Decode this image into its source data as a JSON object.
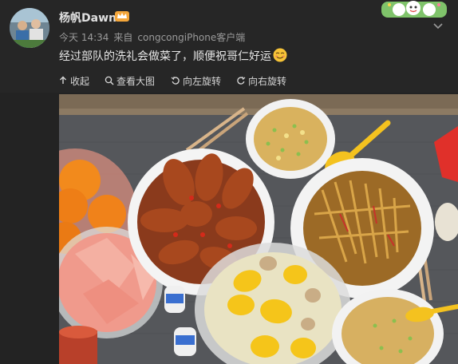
{
  "post": {
    "username": "杨帆Dawn",
    "timestamp": "今天 14:34",
    "source_prefix": "来自",
    "source": "congcongiPhone客户端",
    "text": "经过部队的洗礼会做菜了，顺便祝哥仁好运"
  },
  "toolbar": {
    "collapse_label": "收起",
    "view_large_label": "查看大图",
    "rotate_left_label": "向左旋转",
    "rotate_right_label": "向右旋转"
  },
  "icons": {
    "collapse": "collapse-arrow-icon",
    "view_large": "magnifier-icon",
    "rotate_left": "rotate-left-icon",
    "rotate_right": "rotate-right-icon",
    "badge": "vip-crown-icon",
    "emoji": "smirk-emoji-icon",
    "more": "chevron-down-icon"
  },
  "colors": {
    "background": "#262626",
    "text": "#e6e6e6",
    "meta": "#9a9a9a",
    "badge": "#f4a63a"
  }
}
